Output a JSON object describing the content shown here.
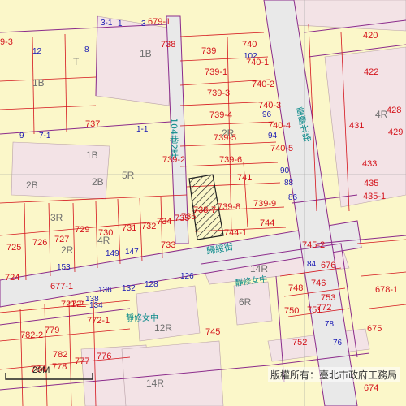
{
  "map": {
    "colors": {
      "parcel": "#fbf7c9",
      "building": "#f3e3e6",
      "road": "#e9e9e9",
      "boundary_red": "#d4141c",
      "boundary_purple": "#8b2b8b",
      "house_blue": "#1a1ab4",
      "label_teal": "#0b8a8a",
      "selected_hatch": "#222222"
    },
    "selected_parcel": "738-7",
    "roads": [
      {
        "id": "guisui-st",
        "name": "歸綏街"
      },
      {
        "id": "chongqing-n-rd",
        "name": "重慶北路"
      },
      {
        "id": "lane-104",
        "name": "104巷2弄"
      }
    ],
    "landmark": "靜修女中",
    "lot_numbers": [
      "679-1",
      "738",
      "739",
      "740",
      "740-1",
      "739-1",
      "740-2",
      "739-3",
      "740-3",
      "739-4",
      "740-4",
      "739-5",
      "740-5",
      "739-6",
      "741",
      "739-2",
      "738-7",
      "739-8",
      "739-9",
      "744",
      "744-1",
      "737",
      "729",
      "731",
      "732",
      "734",
      "735",
      "736",
      "730",
      "727",
      "726",
      "725",
      "733",
      "677-1",
      "724",
      "721-2",
      "721",
      "745",
      "746",
      "748",
      "750",
      "751",
      "752",
      "753",
      "772",
      "772-1",
      "782-2",
      "779",
      "777",
      "776",
      "784",
      "778",
      "782",
      "675",
      "676",
      "674",
      "678-1",
      "420",
      "422",
      "428",
      "429",
      "431",
      "433",
      "435",
      "435-1",
      "9-3",
      "745-2"
    ],
    "house_numbers": [
      "1",
      "3",
      "12",
      "8",
      "9",
      "7-1",
      "102",
      "96",
      "94",
      "90",
      "88",
      "86",
      "149",
      "147",
      "153",
      "138",
      "136",
      "132",
      "128",
      "126",
      "84",
      "78",
      "76",
      "71",
      "1-1",
      "3-1",
      "134"
    ],
    "building_types": [
      "1B",
      "T",
      "2R",
      "2B",
      "3R",
      "4R",
      "5R",
      "6R",
      "12R",
      "14R"
    ],
    "scale": "20M",
    "copyright": "版權所有：臺北市政府工務局"
  }
}
